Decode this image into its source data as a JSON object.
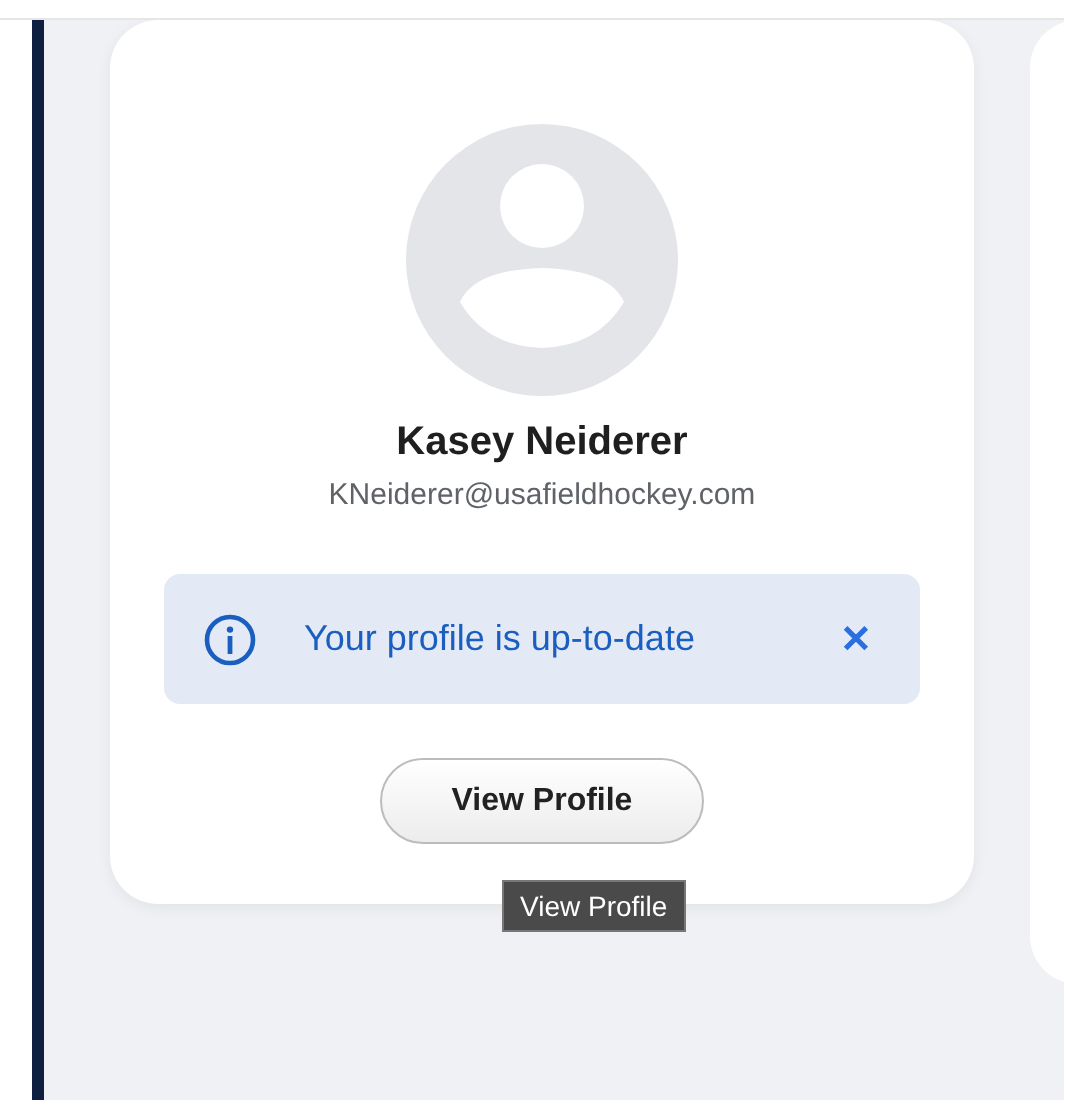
{
  "profile_card": {
    "name": "Kasey Neiderer",
    "email": "KNeiderer@usafieldhockey.com",
    "alert": {
      "message": "Your profile is up-to-date",
      "close": "✕"
    },
    "button": {
      "label": "View Profile"
    },
    "tooltip": "View Profile"
  }
}
